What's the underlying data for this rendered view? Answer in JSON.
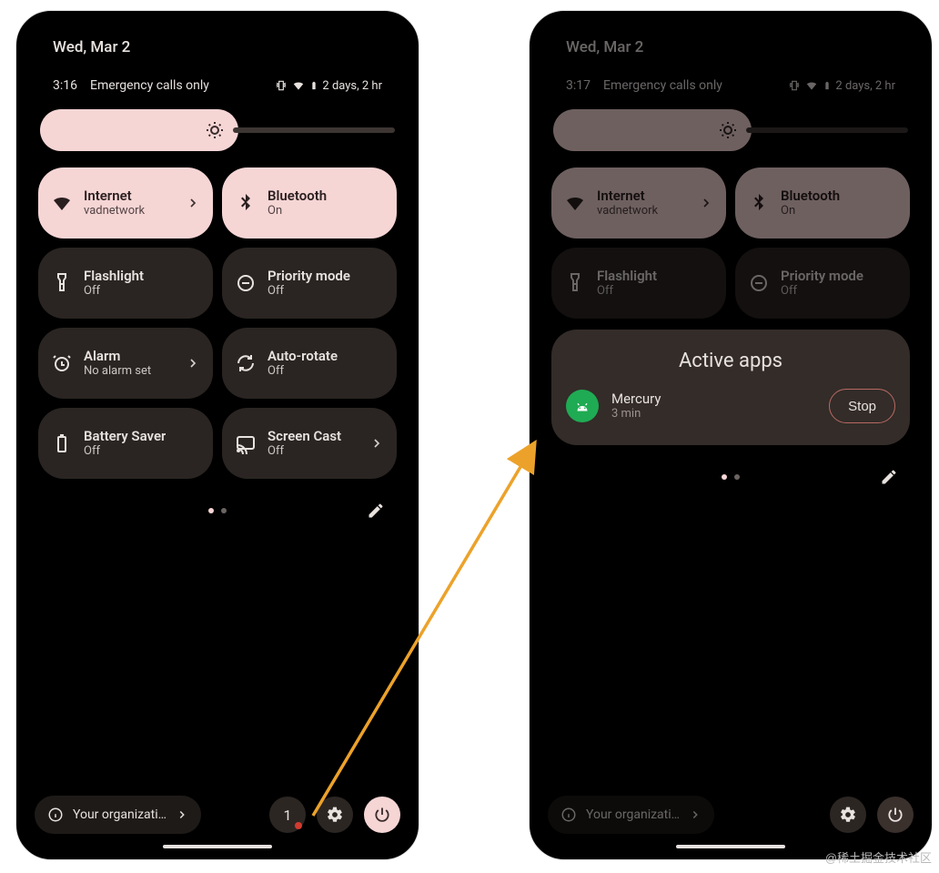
{
  "watermark": "@稀土掘金技术社区",
  "arrow_color": "#eca22a",
  "left_phone": {
    "date": "Wed, Mar 2",
    "status": {
      "time": "3:16",
      "carrier": "Emergency calls only",
      "battery_text": "2 days, 2 hr"
    },
    "tiles": [
      {
        "key": "internet",
        "title": "Internet",
        "subtitle": "vadnetwork",
        "on": true,
        "chevron": true
      },
      {
        "key": "bluetooth",
        "title": "Bluetooth",
        "subtitle": "On",
        "on": true,
        "chevron": false
      },
      {
        "key": "flashlight",
        "title": "Flashlight",
        "subtitle": "Off",
        "on": false,
        "chevron": false
      },
      {
        "key": "priority",
        "title": "Priority mode",
        "subtitle": "Off",
        "on": false,
        "chevron": false
      },
      {
        "key": "alarm",
        "title": "Alarm",
        "subtitle": "No alarm set",
        "on": false,
        "chevron": true
      },
      {
        "key": "autorotate",
        "title": "Auto-rotate",
        "subtitle": "Off",
        "on": false,
        "chevron": false
      },
      {
        "key": "battery",
        "title": "Battery Saver",
        "subtitle": "Off",
        "on": false,
        "chevron": false
      },
      {
        "key": "cast",
        "title": "Screen Cast",
        "subtitle": "Off",
        "on": false,
        "chevron": true
      }
    ],
    "pager": {
      "active": 0,
      "count": 2
    },
    "footer": {
      "org_text": "Your organizati…",
      "active_count": "1",
      "active_badge": true
    }
  },
  "right_phone": {
    "date": "Wed, Mar 2",
    "status": {
      "time": "3:17",
      "carrier": "Emergency calls only",
      "battery_text": "2 days, 2 hr"
    },
    "tiles": [
      {
        "key": "internet",
        "title": "Internet",
        "subtitle": "vadnetwork",
        "on": true,
        "chevron": true
      },
      {
        "key": "bluetooth",
        "title": "Bluetooth",
        "subtitle": "On",
        "on": true,
        "chevron": false
      },
      {
        "key": "flashlight",
        "title": "Flashlight",
        "subtitle": "Off",
        "on": false,
        "chevron": false
      },
      {
        "key": "priority",
        "title": "Priority mode",
        "subtitle": "Off",
        "on": false,
        "chevron": false
      }
    ],
    "active_apps": {
      "title": "Active apps",
      "apps": [
        {
          "name": "Mercury",
          "duration": "3 min",
          "stop_label": "Stop"
        }
      ]
    },
    "pager": {
      "active": 0,
      "count": 2
    },
    "footer": {
      "org_text": "Your organizati…"
    }
  }
}
